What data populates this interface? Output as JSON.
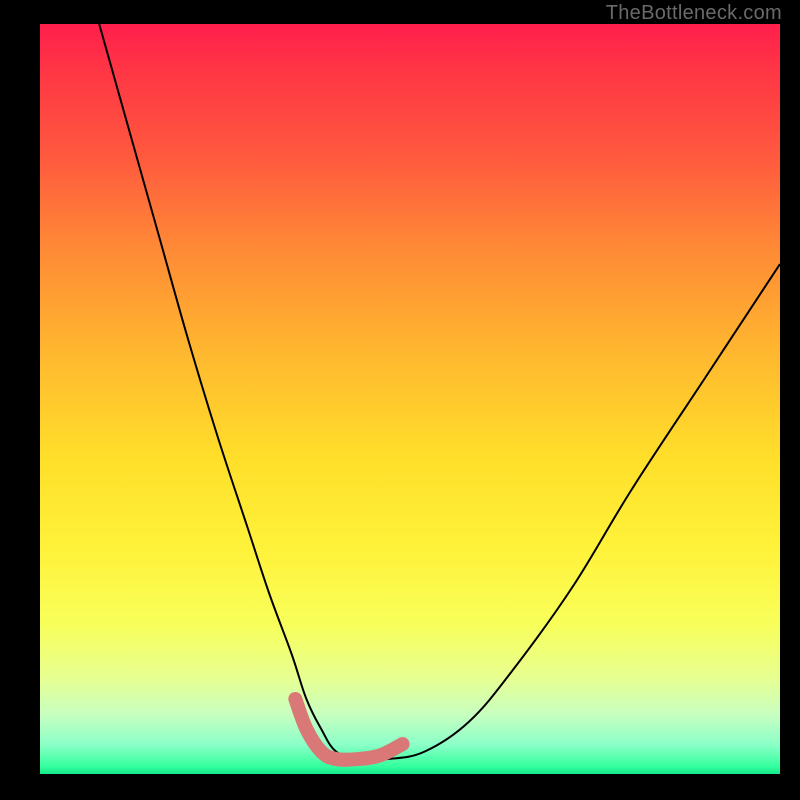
{
  "watermark": "TheBottleneck.com",
  "chart_data": {
    "type": "line",
    "title": "",
    "xlabel": "",
    "ylabel": "",
    "xlim": [
      0,
      100
    ],
    "ylim": [
      0,
      100
    ],
    "grid": false,
    "legend": false,
    "background_gradient": {
      "top": "#ff1f4c",
      "mid": "#ffde2a",
      "bottom": "#14e98a"
    },
    "series": [
      {
        "name": "bottleneck-curve",
        "color": "#000000",
        "stroke_width": 2,
        "x": [
          8,
          12,
          16,
          20,
          24,
          28,
          31,
          34,
          36,
          38,
          40,
          43,
          47,
          52,
          58,
          64,
          72,
          80,
          90,
          100
        ],
        "y": [
          100,
          86,
          72,
          58,
          45,
          33,
          24,
          16,
          10,
          6,
          3,
          2,
          2,
          3,
          7,
          14,
          25,
          38,
          53,
          68
        ]
      },
      {
        "name": "highlighted-minimum-band",
        "color": "#d97877",
        "stroke_width": 14,
        "stroke_linecap": "round",
        "x": [
          34.5,
          36,
          38,
          40,
          43,
          46,
          49
        ],
        "y": [
          10,
          6,
          3,
          2,
          2,
          2.5,
          4
        ]
      }
    ],
    "annotations": []
  }
}
